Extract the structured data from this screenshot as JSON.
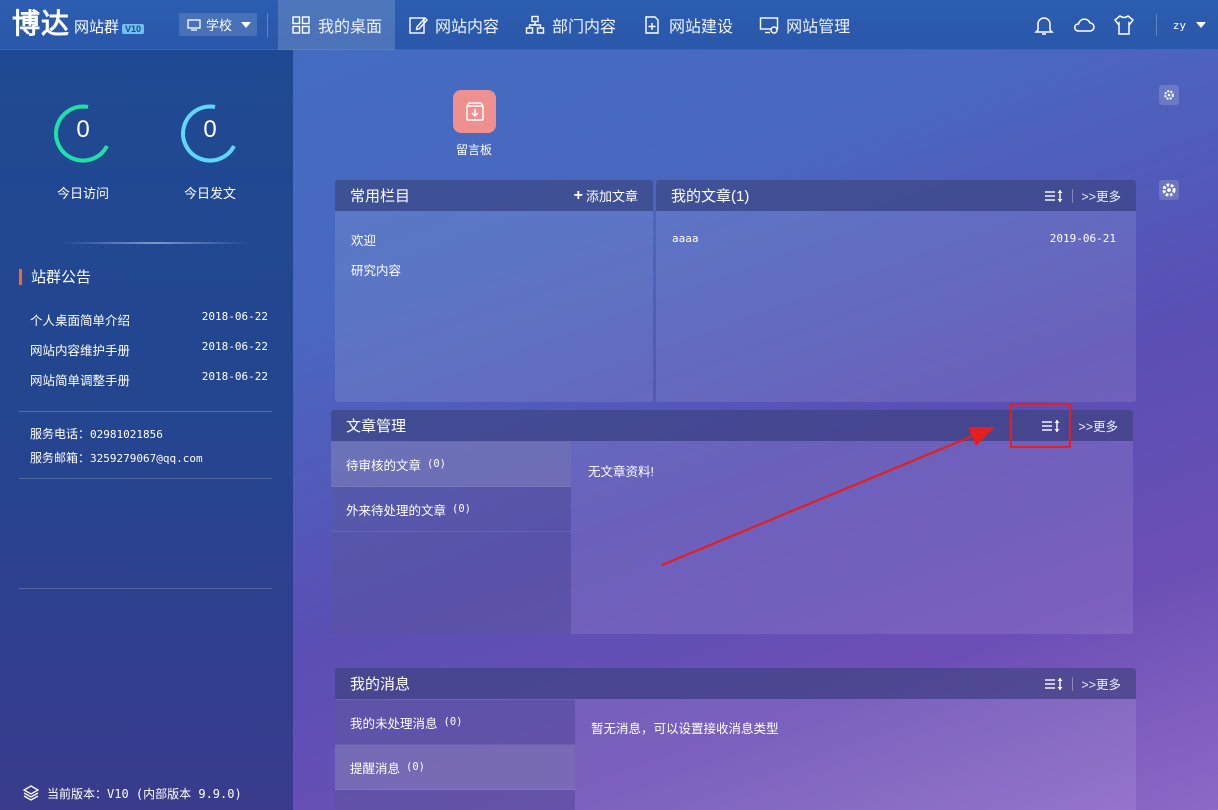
{
  "header": {
    "logo_main": "博达",
    "logo_sub": "网站群",
    "logo_badge": "V10",
    "school_select": "学校",
    "nav": [
      {
        "label": "我的桌面",
        "icon": "grid-icon",
        "active": true
      },
      {
        "label": "网站内容",
        "icon": "edit-icon"
      },
      {
        "label": "部门内容",
        "icon": "org-chart-icon"
      },
      {
        "label": "网站建设",
        "icon": "add-page-icon"
      },
      {
        "label": "网站管理",
        "icon": "monitor-settings-icon"
      }
    ],
    "user": "zy"
  },
  "sidebar": {
    "today_visits_value": "0",
    "today_visits_label": "今日访问",
    "today_posts_value": "0",
    "today_posts_label": "今日发文",
    "notice_title": "站群公告",
    "notices": [
      {
        "title": "个人桌面简单介绍",
        "date": "2018-06-22"
      },
      {
        "title": "网站内容维护手册",
        "date": "2018-06-22"
      },
      {
        "title": "网站简单调整手册",
        "date": "2018-06-22"
      }
    ],
    "phone_label": "服务电话：",
    "phone": "02981021856",
    "email_label": "服务邮箱：",
    "email": "3259279067@qq.com",
    "version": "当前版本：V10 (内部版本 9.9.0)"
  },
  "desktop": {
    "app_label": "留言板"
  },
  "panels": {
    "common_columns": {
      "title": "常用栏目",
      "add_label": "添加文章",
      "items": [
        "欢迎",
        "研究内容"
      ]
    },
    "my_articles": {
      "title": "我的文章(1)",
      "more": ">>更多",
      "items": [
        {
          "title": "aaaa",
          "date": "2019-06-21"
        }
      ]
    },
    "article_mgmt": {
      "title": "文章管理",
      "more": ">>更多",
      "tabs": [
        {
          "label": "待审核的文章",
          "count": "(0)"
        },
        {
          "label": "外来待处理的文章",
          "count": "(0)"
        }
      ],
      "empty": "无文章资料!"
    },
    "my_messages": {
      "title": "我的消息",
      "more": ">>更多",
      "tabs": [
        {
          "label": "我的未处理消息",
          "count": "(0)"
        },
        {
          "label": "提醒消息",
          "count": "(0)"
        }
      ],
      "empty": "暂无消息，可以设置接收消息类型"
    }
  },
  "colors": {
    "accent_orange": "#f26b22",
    "annotation_red": "#e41f1f",
    "gauge_green": "#1fe0a8",
    "gauge_cyan": "#5fd8ff",
    "app_tile": "#ef8f8f"
  }
}
